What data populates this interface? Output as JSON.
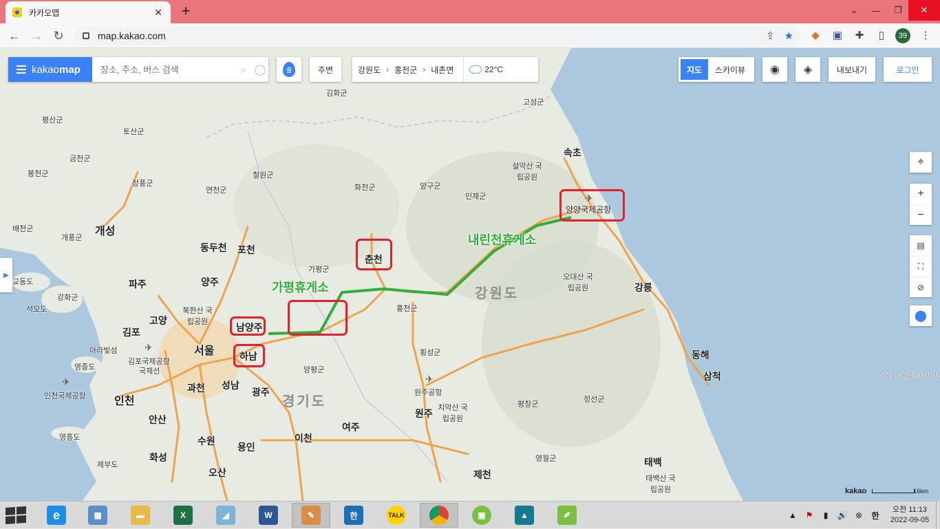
{
  "browser": {
    "tab_title": "카카오맵",
    "close_tab": "✕",
    "new_tab": "+",
    "url": "map.kakao.com",
    "profile_badge": "39"
  },
  "map_ui": {
    "logo_main": "kakao",
    "logo_suffix": "map",
    "search_placeholder": "장소, 주소, 버스 검색",
    "pin_button_label": "출",
    "nearby_label": "주변",
    "breadcrumb": [
      "강원도",
      "홍천군",
      "내촌면"
    ],
    "weather": "22°C",
    "map_type_active": "지도",
    "map_type_other": "스카이뷰",
    "export_label": "내보내기",
    "login_label": "로그인",
    "scale_brand": "kakao",
    "scale_label": "16km"
  },
  "map_labels": {
    "regions": [
      "강원도",
      "경기도"
    ],
    "big_cities": [
      "개성",
      "서울",
      "인천"
    ],
    "cities": [
      "동두천",
      "포천",
      "가평군",
      "파주",
      "양주",
      "고양",
      "김포",
      "과천",
      "성남",
      "광주",
      "안산",
      "수원",
      "용인",
      "이천",
      "여주",
      "오산",
      "화성",
      "원주",
      "제천",
      "강릉",
      "동해",
      "삼척",
      "태백",
      "속초",
      "홍천군",
      "양평군",
      "평창군",
      "정선군",
      "영월군",
      "횡성군",
      "양구군",
      "인제군",
      "화천군",
      "철원군",
      "연천군",
      "김화군",
      "평산군",
      "토산군",
      "금천군",
      "봉천군",
      "장풍군",
      "배천군",
      "개풍군",
      "교동도",
      "강화군",
      "석모도",
      "아라빛섬",
      "영종도",
      "인천국제공항",
      "김포국제공항",
      "국제선",
      "영흥도",
      "제부도",
      "원주공항",
      "치악산 국립공원",
      "오대산 국립공원",
      "설악산 국립공원",
      "북한산 국립공원",
      "태백산 국립공원",
      "고성군",
      "묵호 - 울릉간 (2시간)"
    ],
    "highlighted": [
      "남양주",
      "하남",
      "춘천",
      "양양국제공항"
    ]
  },
  "annotations": {
    "rest_stop_1": "가평휴게소",
    "rest_stop_2": "내린천휴게소"
  },
  "taskbar": {
    "apps": [
      "Internet Explorer",
      "Control Panel",
      "File Explorer",
      "Excel",
      "Sticky",
      "Word",
      "Paint",
      "Hangul",
      "KakaoTalk",
      "Chrome",
      "Evernote",
      "Photos",
      "Notepad++"
    ],
    "kakao_talk_label": "TALK",
    "hangul_label": "한",
    "ime": "한",
    "time": "오전 11:13",
    "date": "2022-09-05"
  },
  "colors": {
    "kakao_blue": "#3b82f6",
    "route_green": "#2fae3c",
    "highlight_red": "#e6202a",
    "road_orange": "#f0a34c",
    "sea_blue": "#abc8de"
  }
}
